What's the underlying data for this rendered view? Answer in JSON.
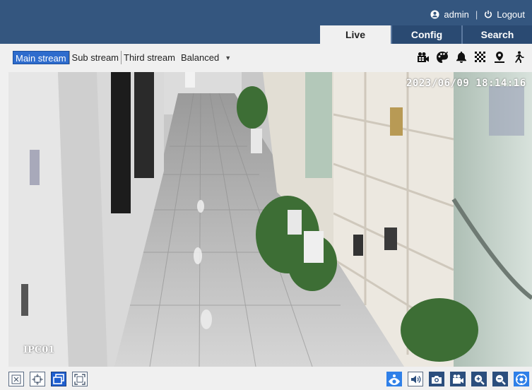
{
  "header": {
    "user": "admin",
    "separator": "|",
    "logout": "Logout",
    "tabs": [
      {
        "label": "Live",
        "active": true
      },
      {
        "label": "Config",
        "active": false
      },
      {
        "label": "Search",
        "active": false
      }
    ]
  },
  "toolbar": {
    "streams": [
      {
        "label": "Main stream",
        "active": true
      },
      {
        "label": "Sub stream",
        "active": false
      },
      {
        "label": "Third stream",
        "active": false
      }
    ],
    "quality": "Balanced",
    "icons": [
      "record-icon",
      "paint-icon",
      "alarm-bell-icon",
      "mosaic-icon",
      "location-icon",
      "person-motion-icon"
    ]
  },
  "video": {
    "timestamp": "2023/06/09 18:14:16",
    "camera_name": "IPC01"
  },
  "bottom": {
    "left_icons": [
      "original-size-icon",
      "fit-window-icon",
      "stretch-icon",
      "fullscreen-icon"
    ],
    "right_icons": [
      "ptz-eye-icon",
      "audio-icon",
      "snapshot-icon",
      "video-record-icon",
      "zoom-in-icon",
      "zoom-out-icon",
      "ptz-control-icon"
    ]
  },
  "colors": {
    "header": "#34567f",
    "active_stream": "#2e6ccd",
    "button_dark": "#2b4e7d",
    "button_blue": "#2f80e8"
  }
}
